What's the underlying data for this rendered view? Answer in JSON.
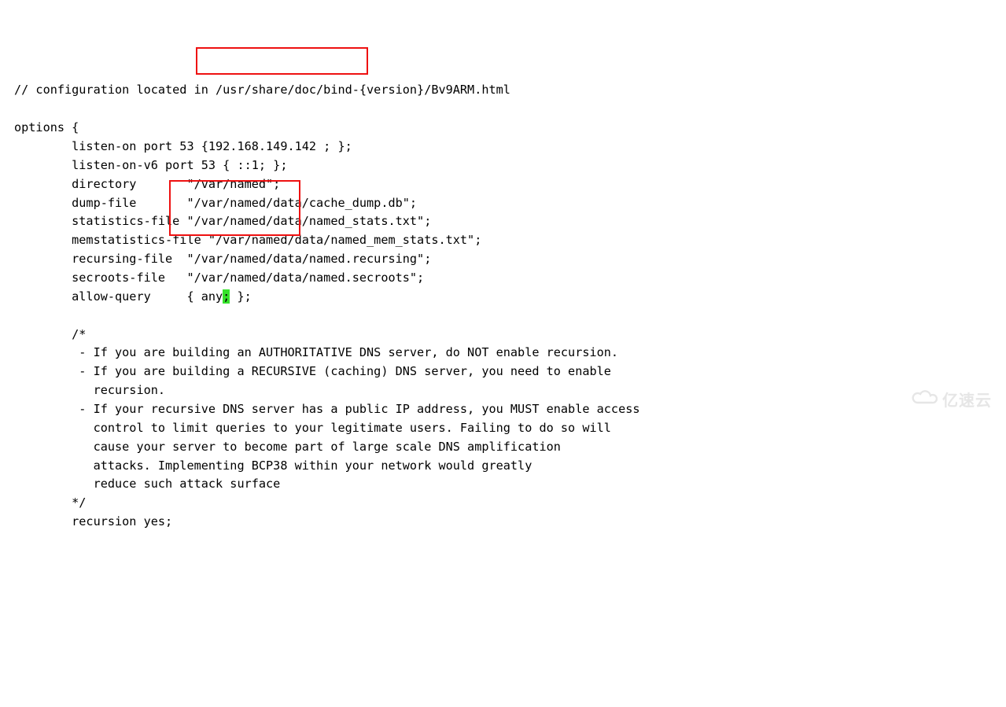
{
  "code": {
    "l01": "// configuration located in /usr/share/doc/bind-{version}/Bv9ARM.html",
    "l02": "",
    "l03": "options {",
    "l04a": "        listen-on port 53 {192.168.149.142 ; };",
    "l05": "        listen-on-v6 port 53 { ::1; };",
    "l06": "        directory       \"/var/named\";",
    "l07": "        dump-file       \"/var/named/data/cache_dump.db\";",
    "l08": "        statistics-file \"/var/named/data/named_stats.txt\";",
    "l09": "        memstatistics-file \"/var/named/data/named_mem_stats.txt\";",
    "l10": "        recursing-file  \"/var/named/data/named.recursing\";",
    "l11": "        secroots-file   \"/var/named/data/named.secroots\";",
    "l12a": "        allow-query     { any",
    "l12b": ";",
    "l12c": " };",
    "l13": "",
    "l14": "        /*",
    "l15": "         - If you are building an AUTHORITATIVE DNS server, do NOT enable recursion.",
    "l16": "         - If you are building a RECURSIVE (caching) DNS server, you need to enable",
    "l17": "           recursion.",
    "l18": "         - If your recursive DNS server has a public IP address, you MUST enable access",
    "l19": "           control to limit queries to your legitimate users. Failing to do so will",
    "l20": "           cause your server to become part of large scale DNS amplification",
    "l21": "           attacks. Implementing BCP38 within your network would greatly",
    "l22": "           reduce such attack surface",
    "l23": "        */",
    "l24": "        recursion yes;"
  },
  "watermark": "亿速云"
}
